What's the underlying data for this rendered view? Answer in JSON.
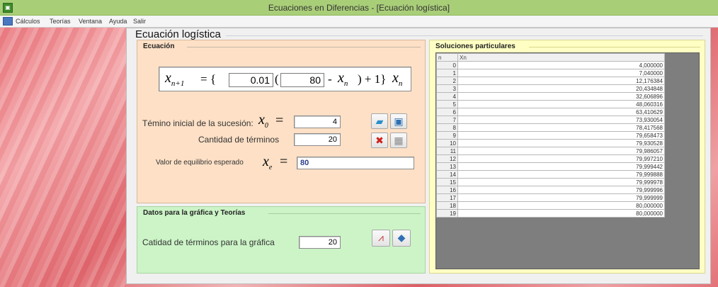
{
  "window": {
    "title": "Ecuaciones en Diferencias - [Ecuación logística]",
    "app_icon": "app-icon"
  },
  "menu": [
    "Cálculos",
    "Teorías",
    "Ventana",
    "Ayuda",
    "Salir"
  ],
  "form": {
    "title": "Ecuación logística",
    "ecuacion_group": {
      "label": "Ecuación",
      "equation": {
        "lhs_var": "x",
        "lhs_sub": "n+1",
        "equals": "= {",
        "rate_value": "0.01",
        "after_rate": "(",
        "capacity_value": "80",
        "minus": "-",
        "x": "x",
        "x_sub": "n",
        "close": ") + 1}",
        "x2": "x",
        "x2_sub": "n"
      },
      "initial_term_label": "Témino inicial de la sucesión:",
      "initial_term_var": "x",
      "initial_term_sub": "0",
      "initial_term_eq": "=",
      "initial_term_value": "4",
      "num_terms_label": "Cantidad de términos",
      "num_terms_value": "20",
      "equilibrium_label": "Valor de equilibrio esperado",
      "equilibrium_var": "x",
      "equilibrium_sub": "e",
      "equilibrium_eq": "=",
      "equilibrium_value": "80",
      "buttons": [
        {
          "name": "open-folder-icon",
          "glyph": "📂",
          "color": "#2a8fc9"
        },
        {
          "name": "save-icon",
          "glyph": "💾",
          "color": "#2d6fb3"
        },
        {
          "name": "delete-icon",
          "glyph": "✖",
          "color": "#d0201a"
        },
        {
          "name": "calculator-icon",
          "glyph": "▦",
          "color": "#8a8a8a"
        }
      ]
    },
    "datos_group": {
      "label": "Datos para la gráfica y Teorías",
      "graph_terms_label": "Catidad de términos para la gráfica",
      "graph_terms_value": "20",
      "buttons": [
        {
          "name": "chart-icon",
          "glyph": "📈",
          "color": "#c83a3a"
        },
        {
          "name": "book-icon",
          "glyph": "📘",
          "color": "#2f6fb5"
        }
      ]
    },
    "soluciones_group": {
      "label": "Soluciones particulares",
      "columns": [
        "n",
        "Xn"
      ],
      "rows": [
        [
          "0",
          "4,000000"
        ],
        [
          "1",
          "7,040000"
        ],
        [
          "2",
          "12,176384"
        ],
        [
          "3",
          "20,434848"
        ],
        [
          "4",
          "32,606896"
        ],
        [
          "5",
          "48,060316"
        ],
        [
          "6",
          "63,410629"
        ],
        [
          "7",
          "73,930054"
        ],
        [
          "8",
          "78,417568"
        ],
        [
          "9",
          "79,658473"
        ],
        [
          "10",
          "79,930528"
        ],
        [
          "11",
          "79,986057"
        ],
        [
          "12",
          "79,997210"
        ],
        [
          "13",
          "79,999442"
        ],
        [
          "14",
          "79,999888"
        ],
        [
          "15",
          "79,999978"
        ],
        [
          "16",
          "79,999996"
        ],
        [
          "17",
          "79,999999"
        ],
        [
          "18",
          "80,000000"
        ],
        [
          "19",
          "80,000000"
        ]
      ]
    }
  }
}
